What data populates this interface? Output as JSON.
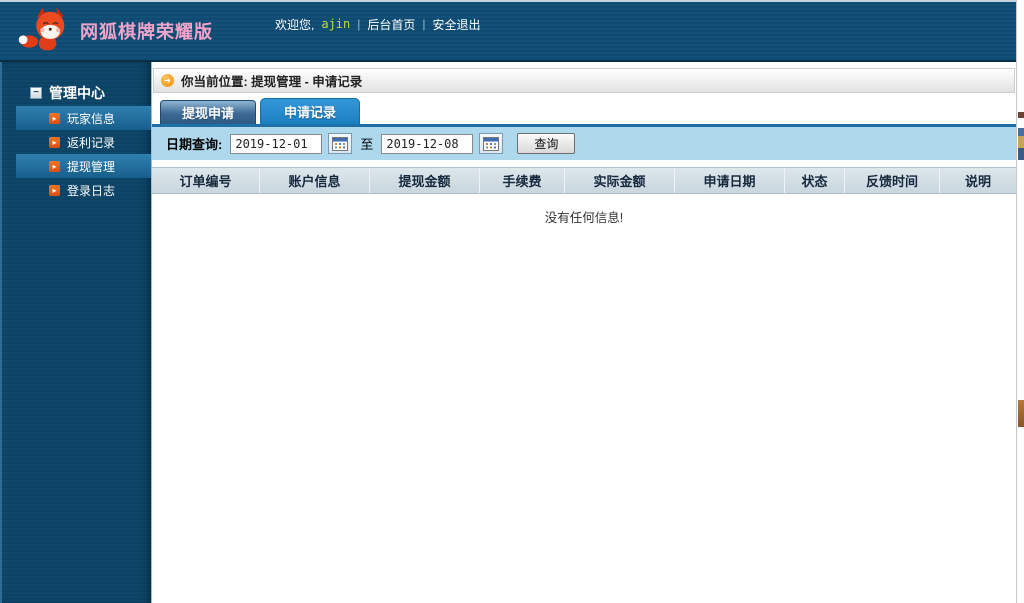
{
  "header": {
    "title": "网狐棋牌荣耀版",
    "welcome_prefix": "欢迎您,",
    "username": "ajin",
    "separator": "|",
    "links": [
      "后台首页",
      "安全退出"
    ]
  },
  "sidebar": {
    "section": "管理中心",
    "items": [
      {
        "label": "玩家信息",
        "highlighted": true
      },
      {
        "label": "返利记录",
        "highlighted": false
      },
      {
        "label": "提现管理",
        "highlighted": true
      },
      {
        "label": "登录日志",
        "highlighted": false
      }
    ]
  },
  "main": {
    "breadcrumb": "你当前位置: 提现管理 - 申请记录",
    "tabs": [
      {
        "label": "提现申请",
        "active": false
      },
      {
        "label": "申请记录",
        "active": true
      }
    ],
    "filter": {
      "label": "日期查询:",
      "from": "2019-12-01",
      "to_label": "至",
      "to": "2019-12-08",
      "search_button": "查询"
    },
    "table": {
      "columns": [
        "订单编号",
        "账户信息",
        "提现金额",
        "手续费",
        "实际金额",
        "申请日期",
        "状态",
        "反馈时间",
        "说明"
      ]
    },
    "empty_message": "没有任何信息!"
  },
  "icons": {
    "logo": "fox-mascot",
    "breadcrumb_arrow": "➜",
    "section_toggle": "−",
    "nav_bullet": "▸",
    "calendar": "calendar-grid"
  },
  "colors": {
    "header_bg": "#0f4a72",
    "sidebar_bg": "#0c4263",
    "nav_highlight": "#1f6f9e",
    "title_pink": "#f2a3c9",
    "username_green": "#c8da3c",
    "tab_active": "#1a7fc0",
    "tab_inactive_dark": "#3c6a96",
    "filter_bg": "#aed8ec",
    "table_header_bg": "#c9d6de",
    "accent_orange": "#e8641c"
  }
}
